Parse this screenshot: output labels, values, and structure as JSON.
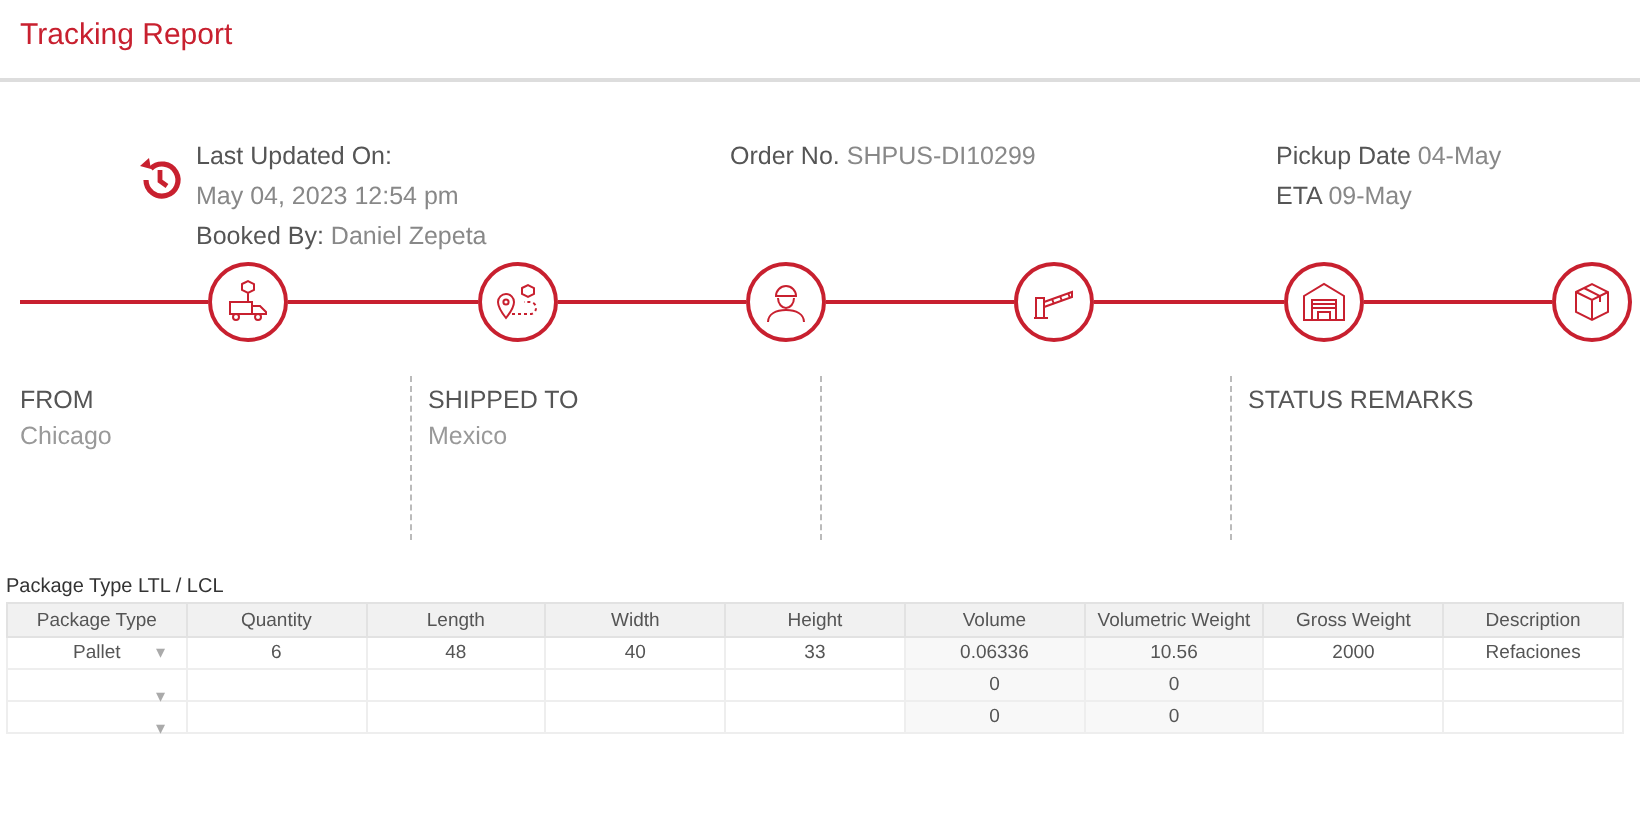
{
  "title": "Tracking Report",
  "header": {
    "last_updated_label": "Last Updated On:",
    "last_updated": "May 04, 2023 12:54 pm",
    "booked_by_label": "Booked By:",
    "booked_by": "Daniel Zepeta",
    "order_label": "Order No.",
    "order_no": "SHPUS-DI10299",
    "pickup_label": "Pickup Date",
    "pickup_date": "04-May",
    "eta_label": "ETA",
    "eta": "09-May"
  },
  "info_columns": [
    {
      "heading": "FROM",
      "value": "Chicago"
    },
    {
      "heading": "SHIPPED TO",
      "value": "Mexico"
    },
    {},
    {
      "heading": "STATUS REMARKS"
    }
  ],
  "table": {
    "caption": "Package Type LTL / LCL",
    "columns": [
      "Package Type",
      "Quantity",
      "Length",
      "Width",
      "Height",
      "Volume",
      "Volumetric Weight",
      "Gross Weight",
      "Description"
    ],
    "rows": [
      {
        "caret": "▾",
        "cells": [
          "Pallet",
          "6",
          "48",
          "40",
          "33",
          "0.06336",
          "10.56",
          "2000",
          "Refaciones"
        ]
      },
      {
        "caret": "▾",
        "cells": [
          null,
          null,
          null,
          null,
          null,
          "0",
          "0",
          null,
          null
        ]
      },
      {
        "caret": "▾",
        "cells": [
          null,
          null,
          null,
          null,
          null,
          "0",
          "0",
          null,
          null
        ]
      }
    ]
  }
}
